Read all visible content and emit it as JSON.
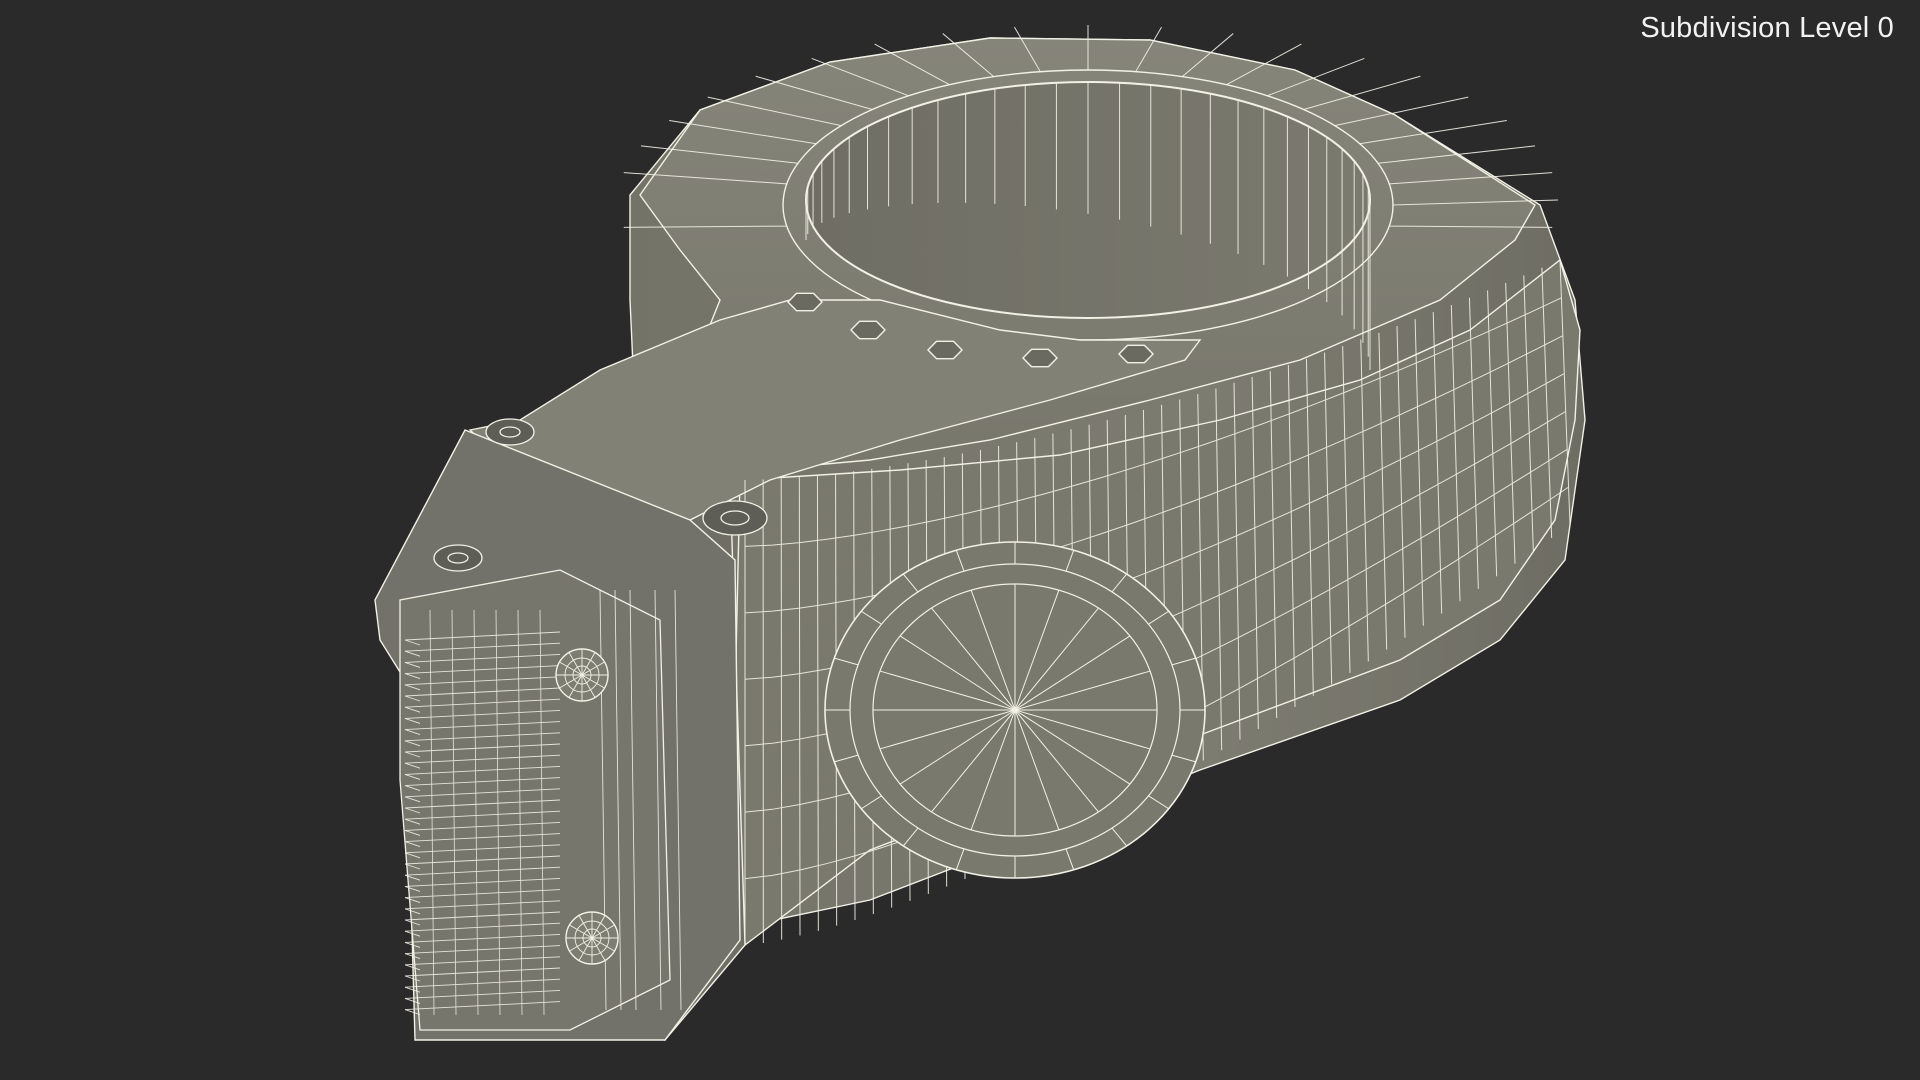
{
  "overlay": {
    "label": "Subdivision Level 0"
  },
  "scene": {
    "background_color": "#2a2a2a",
    "surface_color": "#7c7b6f",
    "wire_color": "#f2f1e6"
  }
}
